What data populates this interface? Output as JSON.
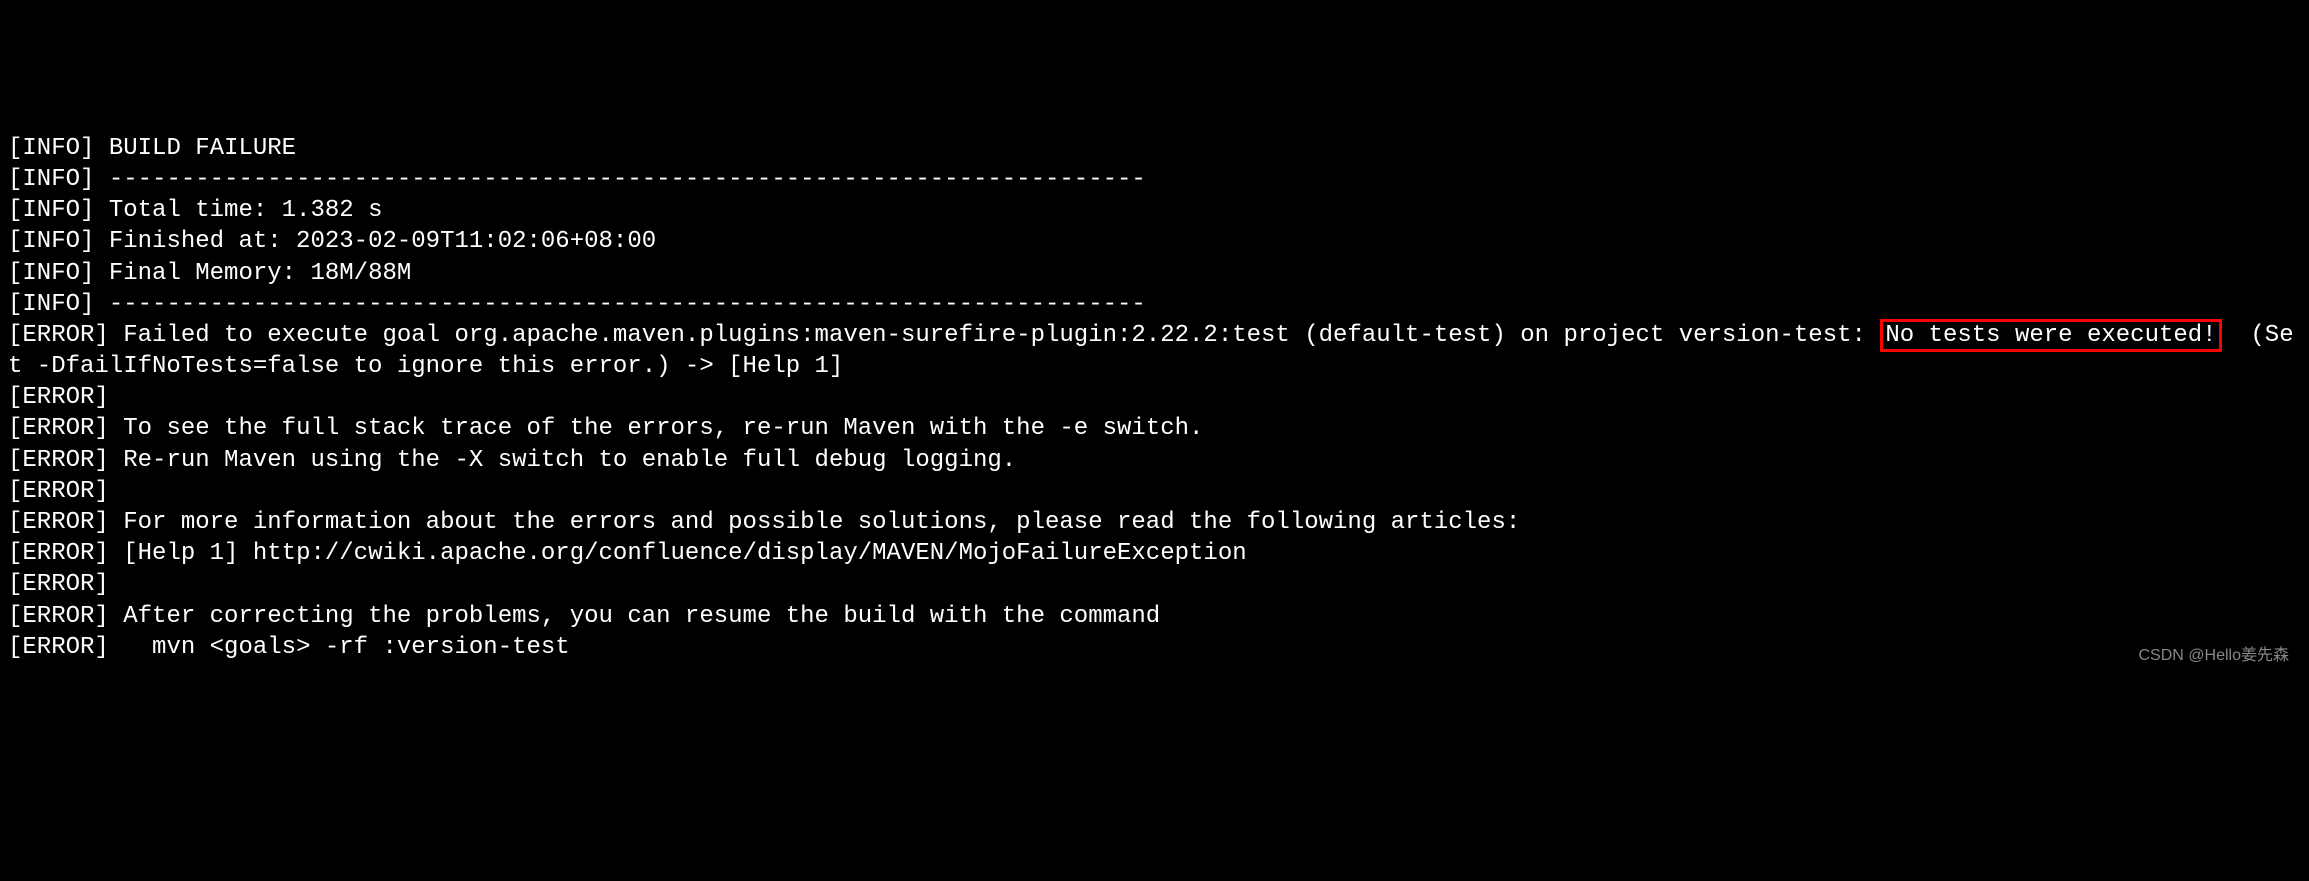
{
  "terminal": {
    "lines": [
      {
        "prefix": "[INFO]",
        "text": "BUILD FAILURE"
      },
      {
        "prefix": "[INFO]",
        "text": "------------------------------------------------------------------------"
      },
      {
        "prefix": "[INFO]",
        "text": "Total time: 1.382 s"
      },
      {
        "prefix": "[INFO]",
        "text": "Finished at: 2023-02-09T11:02:06+08:00"
      },
      {
        "prefix": "[INFO]",
        "text": "Final Memory: 18M/88M"
      },
      {
        "prefix": "[INFO]",
        "text": "------------------------------------------------------------------------"
      }
    ],
    "error_line_wrap": {
      "prefix": "[ERROR]",
      "part1": "Failed to execute goal org.apache.maven.plugins:maven-surefire-plugin:2.22.2:test (default-test) on project version-test: ",
      "highlighted": "No tests were executed!",
      "part2": "  (Set -DfailIfNoTests=false to ignore this error.) -> [Help 1]"
    },
    "error_lines": [
      {
        "prefix": "[ERROR]",
        "text": ""
      },
      {
        "prefix": "[ERROR]",
        "text": "To see the full stack trace of the errors, re-run Maven with the -e switch."
      },
      {
        "prefix": "[ERROR]",
        "text": "Re-run Maven using the -X switch to enable full debug logging."
      },
      {
        "prefix": "[ERROR]",
        "text": ""
      },
      {
        "prefix": "[ERROR]",
        "text": "For more information about the errors and possible solutions, please read the following articles:"
      },
      {
        "prefix": "[ERROR]",
        "text": "[Help 1] http://cwiki.apache.org/confluence/display/MAVEN/MojoFailureException"
      },
      {
        "prefix": "[ERROR]",
        "text": ""
      },
      {
        "prefix": "[ERROR]",
        "text": "After correcting the problems, you can resume the build with the command"
      },
      {
        "prefix": "[ERROR]",
        "text": "  mvn <goals> -rf :version-test"
      }
    ]
  },
  "watermark": "CSDN @Hello姜先森"
}
